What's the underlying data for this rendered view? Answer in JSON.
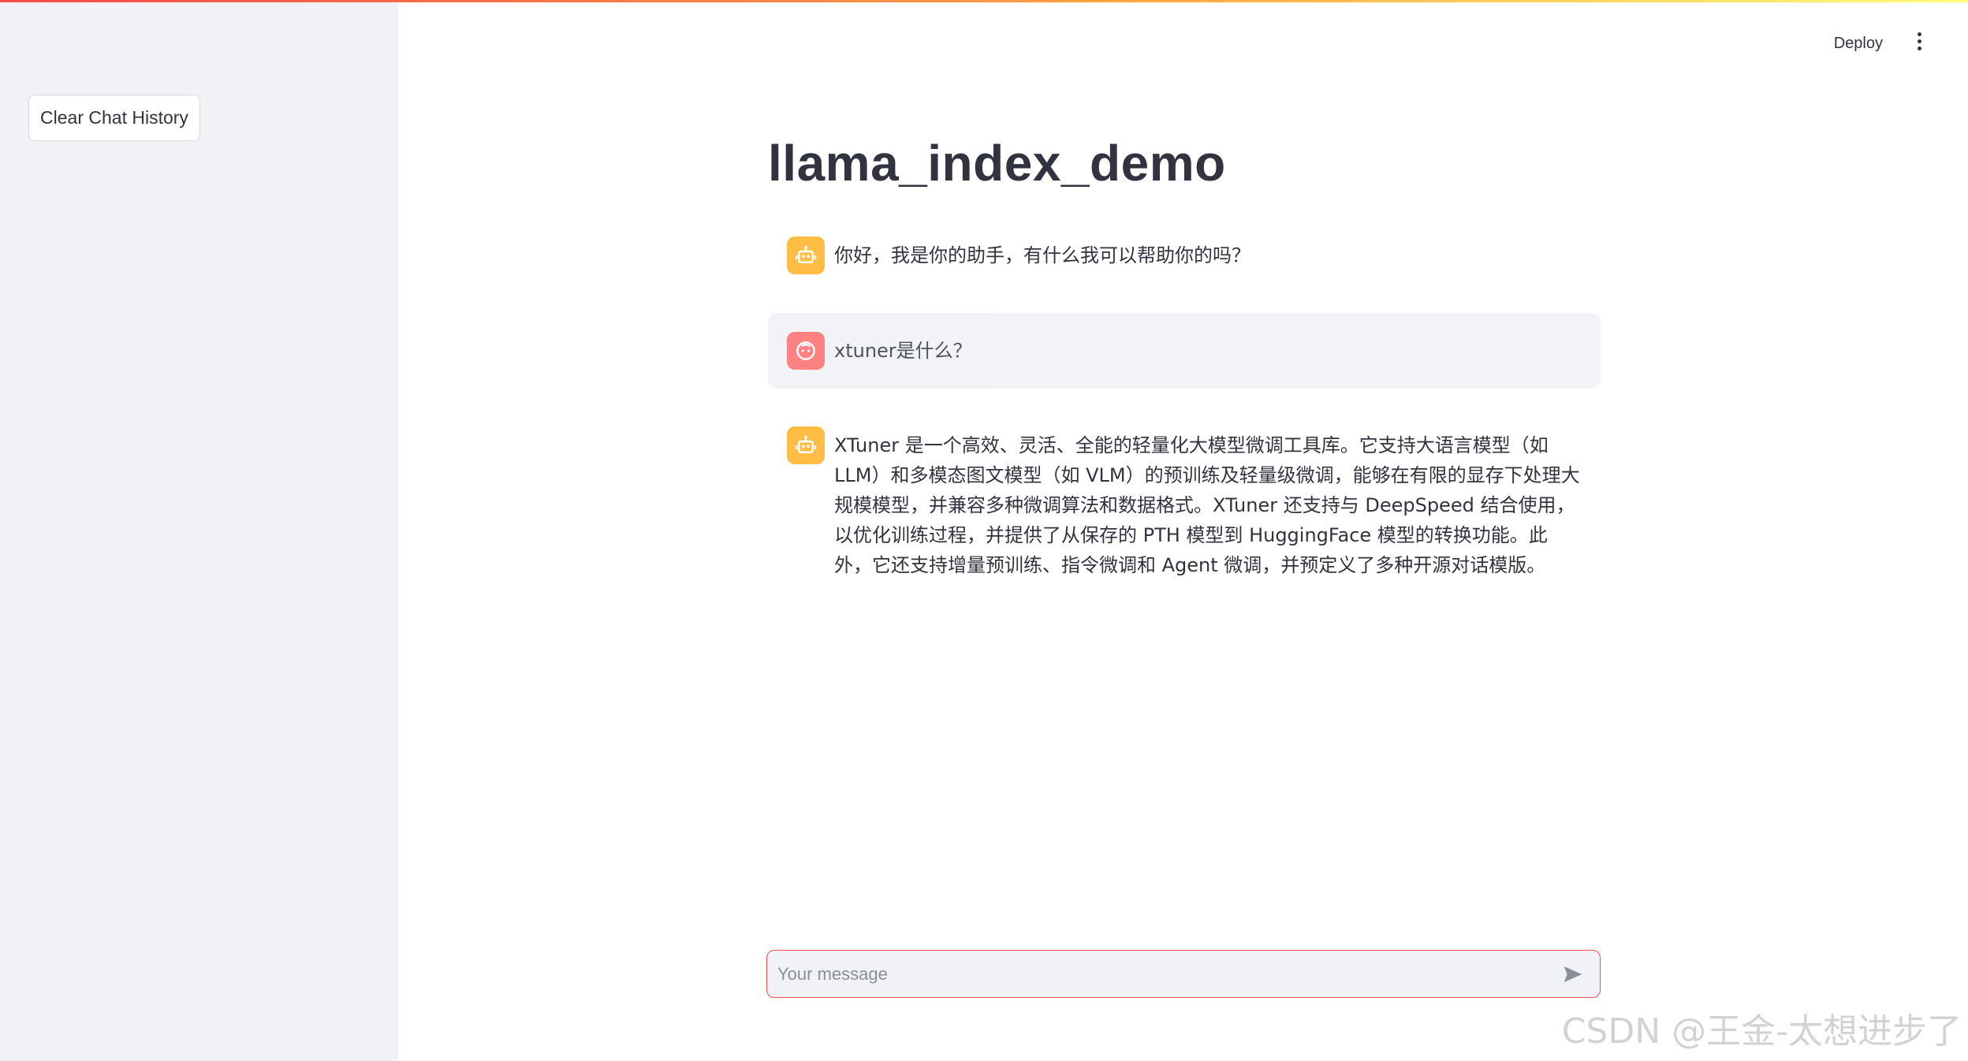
{
  "sidebar": {
    "clear_button_label": "Clear Chat History"
  },
  "header": {
    "deploy_label": "Deploy",
    "menu_icon": "kebab-menu-icon"
  },
  "main": {
    "title": "llama_index_demo"
  },
  "messages": [
    {
      "role": "assistant",
      "avatar_icon": "robot-icon",
      "text": "你好，我是你的助手，有什么我可以帮助你的吗？"
    },
    {
      "role": "user",
      "avatar_icon": "user-face-icon",
      "text": "xtuner是什么？"
    },
    {
      "role": "assistant",
      "avatar_icon": "robot-icon",
      "text": "XTuner 是一个高效、灵活、全能的轻量化大模型微调工具库。它支持大语言模型（如 LLM）和多模态图文模型（如 VLM）的预训练及轻量级微调，能够在有限的显存下处理大规模模型，并兼容多种微调算法和数据格式。XTuner 还支持与 DeepSpeed 结合使用，以优化训练过程，并提供了从保存的 PTH 模型到 HuggingFace 模型的转换功能。此外，它还支持增量预训练、指令微调和 Agent 微调，并预定义了多种开源对话模版。"
    }
  ],
  "chat_input": {
    "placeholder": "Your message",
    "value": ""
  },
  "watermark": "CSDN @王金-太想进步了",
  "colors": {
    "accent": "#ff4b4b",
    "sidebar_bg": "#f0f2f6",
    "bot_avatar": "#ffbd45",
    "user_avatar": "#ff6c6c"
  }
}
